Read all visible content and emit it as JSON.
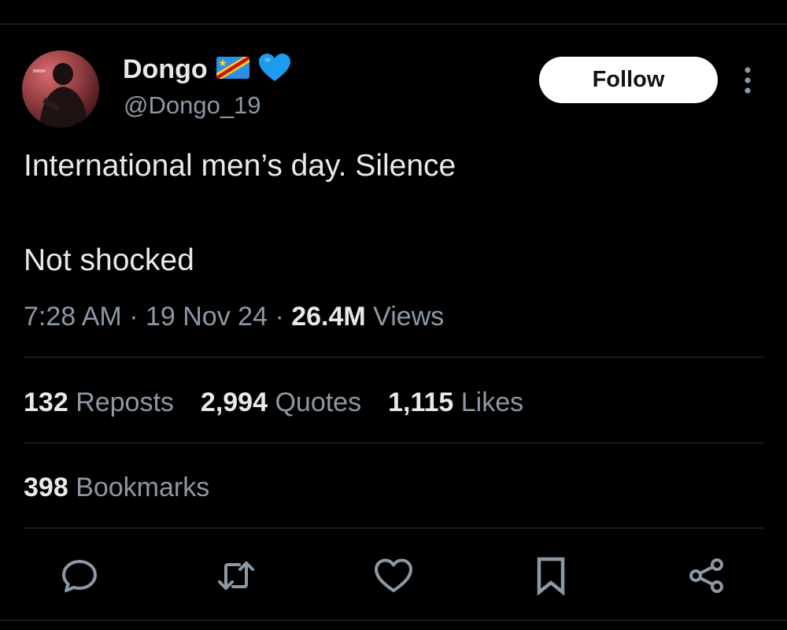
{
  "user": {
    "display_name": "Dongo",
    "handle": "@Dongo_19",
    "name_emoji_icons": [
      "dr-congo-flag-icon",
      "blue-heart-icon"
    ]
  },
  "follow_button": {
    "label": "Follow"
  },
  "more_options": {
    "icon": "more-vertical-icon"
  },
  "tweet": {
    "line1": "International men’s day. Silence",
    "line2": "Not shocked"
  },
  "meta": {
    "time": "7:28 AM",
    "separator": "·",
    "date": "19 Nov 24",
    "views_count": "26.4M",
    "views_label": "Views"
  },
  "stats": {
    "reposts": {
      "count": "132",
      "label": "Reposts"
    },
    "quotes": {
      "count": "2,994",
      "label": "Quotes"
    },
    "likes": {
      "count": "1,115",
      "label": "Likes"
    },
    "bookmarks": {
      "count": "398",
      "label": "Bookmarks"
    }
  },
  "actions": [
    "reply-icon",
    "repost-icon",
    "like-icon",
    "bookmark-icon",
    "share-icon"
  ],
  "colors": {
    "background": "#000000",
    "primary_text": "#e7e9ea",
    "secondary_text": "#8b98a5",
    "divider": "#2f3336",
    "follow_bg": "#ffffff",
    "follow_text": "#0f1419",
    "heart_blue": "#1d9bf0"
  }
}
